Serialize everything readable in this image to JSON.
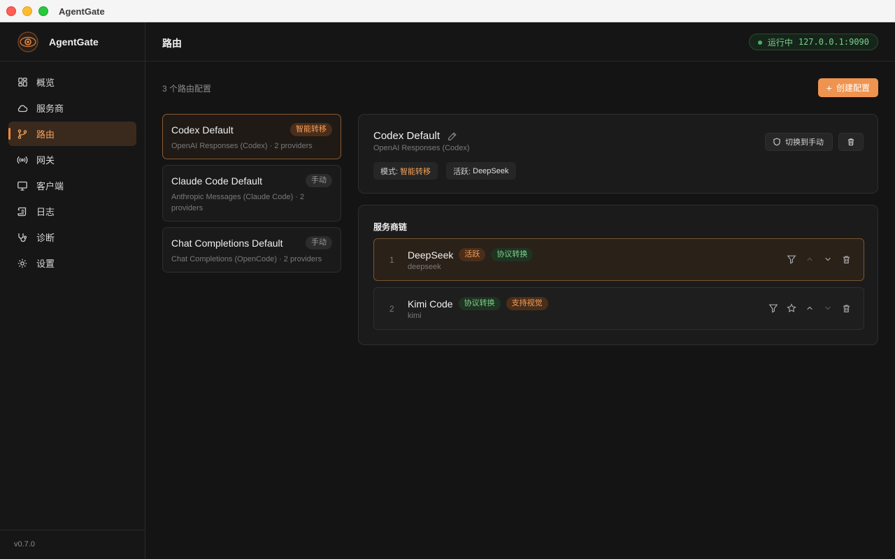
{
  "window": {
    "title": "AgentGate"
  },
  "brand": {
    "name": "AgentGate"
  },
  "nav": {
    "items": [
      {
        "label": "概览",
        "icon": "dashboard-icon"
      },
      {
        "label": "服务商",
        "icon": "cloud-icon"
      },
      {
        "label": "路由",
        "icon": "route-icon",
        "active": true
      },
      {
        "label": "网关",
        "icon": "broadcast-icon"
      },
      {
        "label": "客户端",
        "icon": "monitor-icon"
      },
      {
        "label": "日志",
        "icon": "scroll-icon"
      },
      {
        "label": "诊断",
        "icon": "stethoscope-icon"
      },
      {
        "label": "设置",
        "icon": "gear-icon"
      }
    ]
  },
  "version": "v0.7.0",
  "header": {
    "title": "路由",
    "status": {
      "label": "运行中",
      "address": "127.0.0.1:9090"
    }
  },
  "toolbar": {
    "count_text": "3 个路由配置",
    "create_label": "创建配置"
  },
  "routes": [
    {
      "name": "Codex Default",
      "badge": "智能转移",
      "subtitle": "OpenAI Responses (Codex) · 2 providers"
    },
    {
      "name": "Claude Code Default",
      "badge": "手动",
      "subtitle": "Anthropic Messages (Claude Code) · 2 providers"
    },
    {
      "name": "Chat Completions Default",
      "badge": "手动",
      "subtitle": "Chat Completions (OpenCode) · 2 providers"
    }
  ],
  "detail": {
    "name": "Codex Default",
    "subtitle": "OpenAI Responses (Codex)",
    "switch_label": "切换到手动",
    "mode_label": "模式:",
    "mode_value": "智能转移",
    "active_label": "活跃:",
    "active_value": "DeepSeek"
  },
  "chain": {
    "title": "服务商链",
    "providers": [
      {
        "index": "1",
        "name": "DeepSeek",
        "id": "deepseek",
        "badges": [
          "活跃",
          "协议转换"
        ]
      },
      {
        "index": "2",
        "name": "Kimi Code",
        "id": "kimi",
        "badges": [
          "协议转换",
          "支持视觉"
        ]
      }
    ]
  },
  "colors": {
    "accent": "#ef9450",
    "status_green": "#4caf66",
    "background": "#141414"
  }
}
